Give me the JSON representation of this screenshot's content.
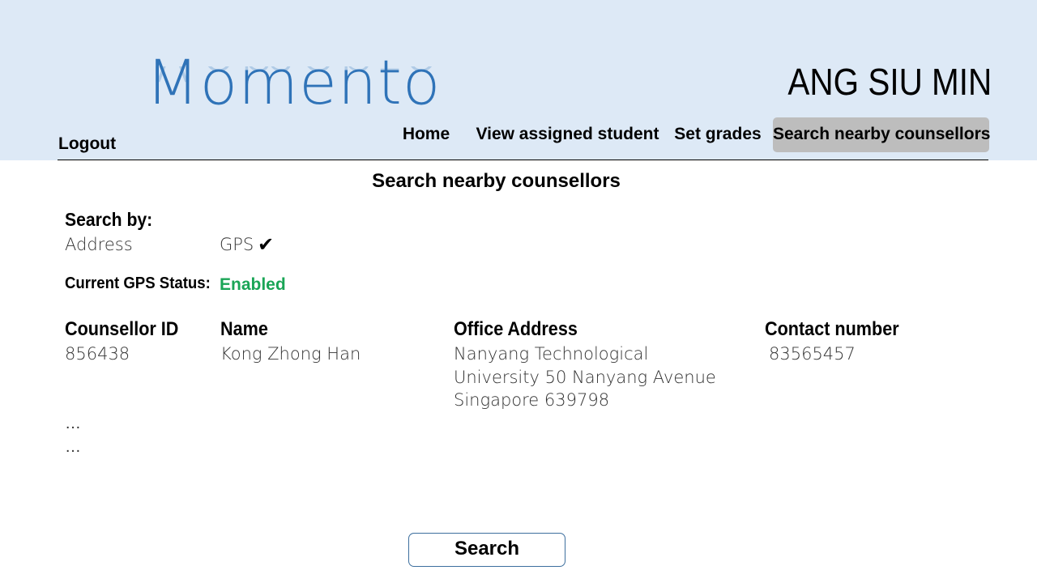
{
  "header": {
    "logo_text": "Momento",
    "user_name": "ANG SIU MIN",
    "logout_label": "Logout",
    "colors": {
      "background": "#dde9f6",
      "logo": "#2f73b8",
      "active_tab": "#bdbdbd"
    }
  },
  "nav": {
    "items": [
      {
        "label": "Home",
        "active": false
      },
      {
        "label": "View assigned student",
        "active": false
      },
      {
        "label": "Set grades",
        "active": false
      },
      {
        "label": "Search nearby counsellors",
        "active": true
      }
    ]
  },
  "main": {
    "title": "Search nearby counsellors",
    "search_by": {
      "label": "Search by:",
      "options": [
        {
          "label": "Address",
          "selected": false
        },
        {
          "label": "GPS",
          "selected": true
        }
      ],
      "check_icon": "check-icon"
    },
    "gps_status": {
      "label": "Current GPS Status:",
      "value": "Enabled",
      "color": "#1aa556"
    },
    "table": {
      "headers": [
        "Counsellor ID",
        "Name",
        "Office Address",
        "Contact number"
      ],
      "rows": [
        {
          "id": "856438",
          "name": "Kong Zhong Han",
          "address_lines": [
            "Nanyang Technological",
            "University 50 Nanyang Avenue",
            "Singapore 639798"
          ],
          "contact": "83565457"
        }
      ],
      "more_rows": [
        "…",
        "…"
      ]
    },
    "search_button_label": "Search"
  }
}
